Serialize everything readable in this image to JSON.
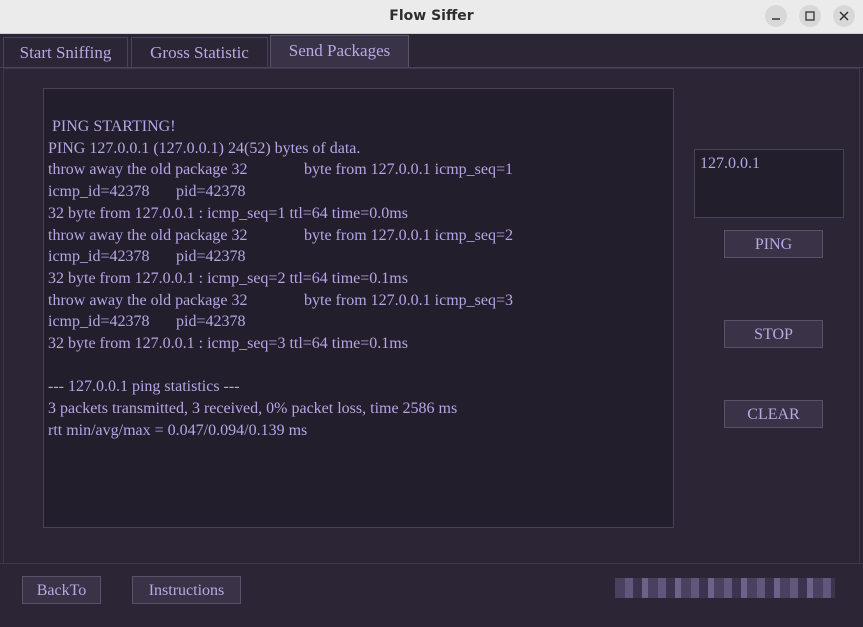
{
  "window": {
    "title": "Flow Siffer"
  },
  "tabs": [
    {
      "label": "Start Sniffing"
    },
    {
      "label": "Gross Statistic"
    },
    {
      "label": "Send Packages"
    }
  ],
  "output": {
    "text": " PING STARTING!\nPING 127.0.0.1 (127.0.0.1) 24(52) bytes of data.\nthrow away the old package 32\t\tbyte from 127.0.0.1 icmp_seq=1\nicmp_id=42378\tpid=42378\n32 byte from 127.0.0.1 : icmp_seq=1 ttl=64 time=0.0ms\nthrow away the old package 32\t\tbyte from 127.0.0.1 icmp_seq=2\nicmp_id=42378\tpid=42378\n32 byte from 127.0.0.1 : icmp_seq=2 ttl=64 time=0.1ms\nthrow away the old package 32\t\tbyte from 127.0.0.1 icmp_seq=3\nicmp_id=42378\tpid=42378\n32 byte from 127.0.0.1 : icmp_seq=3 ttl=64 time=0.1ms\n\n--- 127.0.0.1 ping statistics ---\n3 packets transmitted, 3 received, 0% packet loss, time 2586 ms\nrtt min/avg/max = 0.047/0.094/0.139 ms"
  },
  "target": {
    "value": "127.0.0.1"
  },
  "buttons": {
    "ping": "PING",
    "stop": "STOP",
    "clear": "CLEAR",
    "back": "BackTo",
    "instructions": "Instructions"
  },
  "icons": {
    "minimize": "minimize-icon",
    "maximize": "maximize-icon",
    "close": "close-icon"
  },
  "colors": {
    "background": "#2b2536",
    "text": "#b5a6e6",
    "titlebar": "#ebebeb"
  }
}
